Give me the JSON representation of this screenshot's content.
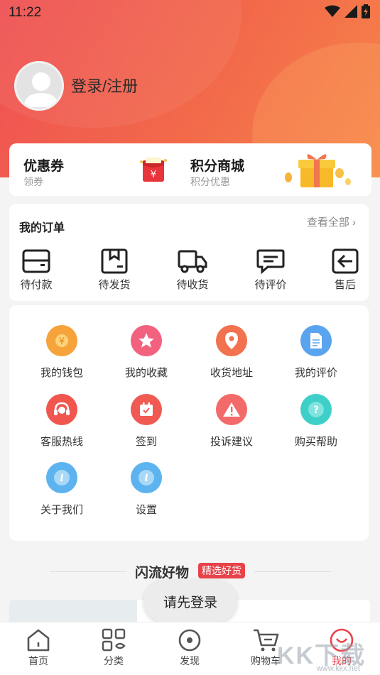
{
  "status_bar": {
    "time": "11:22",
    "icons": [
      "wifi-icon",
      "signal-icon",
      "battery-icon"
    ]
  },
  "profile": {
    "login_label": "登录/注册"
  },
  "promo": {
    "coupon": {
      "title": "优惠券",
      "subtitle": "领券",
      "icon_glyph": "¥"
    },
    "points": {
      "title": "积分商城",
      "subtitle": "积分优惠"
    }
  },
  "orders": {
    "title": "我的订单",
    "view_all": "查看全部",
    "items": [
      {
        "label": "待付款",
        "icon": "wallet-icon"
      },
      {
        "label": "待发货",
        "icon": "package-icon"
      },
      {
        "label": "待收货",
        "icon": "truck-icon"
      },
      {
        "label": "待评价",
        "icon": "comment-icon"
      },
      {
        "label": "售后",
        "icon": "return-icon"
      }
    ]
  },
  "services": [
    {
      "label": "我的钱包",
      "icon": "wallet-coin-icon",
      "color": "#f6a33b"
    },
    {
      "label": "我的收藏",
      "icon": "star-icon",
      "color": "#f2627f"
    },
    {
      "label": "收货地址",
      "icon": "location-icon",
      "color": "#f2714e"
    },
    {
      "label": "我的评价",
      "icon": "document-icon",
      "color": "#5aa3ee"
    },
    {
      "label": "客服热线",
      "icon": "headset-icon",
      "color": "#f0554e"
    },
    {
      "label": "签到",
      "icon": "calendar-check-icon",
      "color": "#f05a52"
    },
    {
      "label": "投诉建议",
      "icon": "warning-icon",
      "color": "#f26a6a"
    },
    {
      "label": "购买帮助",
      "icon": "help-icon",
      "color": "#3fcfc9"
    },
    {
      "label": "关于我们",
      "icon": "info-icon",
      "color": "#5db3ef"
    },
    {
      "label": "设置",
      "icon": "info-icon",
      "color": "#5db3ef"
    }
  ],
  "goods": {
    "title": "闪流好物",
    "tag": "精选好货"
  },
  "toast": "请先登录",
  "tabbar": [
    {
      "label": "首页",
      "icon": "home-icon",
      "active": false
    },
    {
      "label": "分类",
      "icon": "category-icon",
      "active": false
    },
    {
      "label": "发现",
      "icon": "discover-icon",
      "active": false
    },
    {
      "label": "购物车",
      "icon": "cart-icon",
      "active": false
    },
    {
      "label": "我的",
      "icon": "profile-icon",
      "active": true
    }
  ],
  "watermark": {
    "main": "KK下载",
    "url": "www.kkx.net"
  },
  "colors": {
    "accent": "#e8434a",
    "header_start": "#ef5052",
    "header_end": "#f7854a"
  }
}
